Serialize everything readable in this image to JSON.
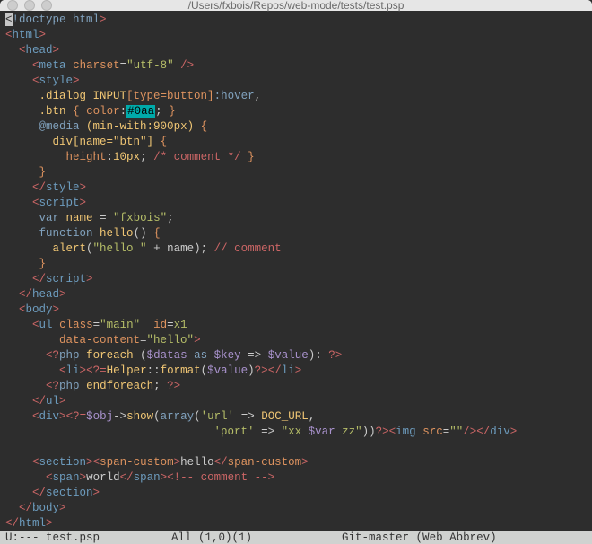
{
  "window": {
    "title": "/Users/fxbois/Repos/web-mode/tests/test.psp"
  },
  "modeline": {
    "left": "U:---  test.psp",
    "mid": "All (1,0)(1)",
    "right": "Git-master  (Web Abbrev)"
  },
  "code": {
    "l1_a": "<",
    "l1_b": "!doctype html",
    "l1_c": ">",
    "l2_a": "<",
    "l2_tag": "html",
    "l2_c": ">",
    "l3_pre": "  ",
    "l3_a": "<",
    "l3_tag": "head",
    "l3_c": ">",
    "l4_pre": "    ",
    "l4_a": "<",
    "l4_tag": "meta",
    "l4_sp": " ",
    "l4_attr": "charset",
    "l4_eq": "=",
    "l4_val": "\"utf-8\"",
    "l4_close": " />",
    "l5_pre": "    ",
    "l5_a": "<",
    "l5_tag": "style",
    "l5_c": ">",
    "l6_pre": "     ",
    "l6_sel": ".dialog INPUT",
    "l6_bsel": "[type=button]",
    "l6_pc": ":hover",
    "l6_comma": ",",
    "l7_pre": "     ",
    "l7_sel": ".btn",
    "l7_sp": " ",
    "l7_b": "{",
    "l7_sp2": " ",
    "l7_prop": "color",
    "l7_colon": ":",
    "l7_val": "#0aa",
    "l7_semi": ";",
    "l7_sp3": " ",
    "l7_bc": "}",
    "l8_pre": "     ",
    "l8_at": "@media",
    "l8_sp": " ",
    "l8_p": "(min-with:900px)",
    "l8_sp2": " ",
    "l8_b": "{",
    "l9_pre": "       ",
    "l9_sel": "div[name=\"btn\"]",
    "l9_sp": " ",
    "l9_b": "{",
    "l10_pre": "         ",
    "l10_prop": "height",
    "l10_colon": ":",
    "l10_val": "10px",
    "l10_semi": ";",
    "l10_sp": " ",
    "l10_cmt": "/* comment */",
    "l10_sp2": " ",
    "l10_bc": "}",
    "l11_pre": "     ",
    "l11_bc": "}",
    "l12_pre": "    ",
    "l12_a": "</",
    "l12_tag": "style",
    "l12_c": ">",
    "l13_pre": "    ",
    "l13_a": "<",
    "l13_tag": "script",
    "l13_c": ">",
    "l14_pre": "     ",
    "l14_kw": "var",
    "l14_sp": " ",
    "l14_name": "name",
    "l14_rest": " = ",
    "l14_str": "\"fxbois\"",
    "l14_semi": ";",
    "l15_pre": "     ",
    "l15_kw": "function",
    "l15_sp": " ",
    "l15_fn": "hello",
    "l15_rest": "() ",
    "l15_b": "{",
    "l16_pre": "       ",
    "l16_fn": "alert",
    "l16_p": "(",
    "l16_str": "\"hello \"",
    "l16_rest": " + name); ",
    "l16_cmt": "// comment",
    "l17_pre": "     ",
    "l17_bc": "}",
    "l18_pre": "    ",
    "l18_a": "</",
    "l18_tag": "script",
    "l18_c": ">",
    "l19_pre": "  ",
    "l19_a": "</",
    "l19_tag": "head",
    "l19_c": ">",
    "l20_pre": "  ",
    "l20_a": "<",
    "l20_tag": "body",
    "l20_c": ">",
    "l21_pre": "    ",
    "l21_a": "<",
    "l21_tag": "ul",
    "l21_sp": " ",
    "l21_at1": "class",
    "l21_eq1": "=",
    "l21_v1": "\"main\"",
    "l21_sp2": "  ",
    "l21_at2": "id",
    "l21_eq2": "=",
    "l21_v2": "x1",
    "l22_pre": "        ",
    "l22_at3": "data-content",
    "l22_eq3": "=",
    "l22_v3": "\"hello\"",
    "l22_c": ">",
    "l23_pre": "      ",
    "l23_a": "<?",
    "l23_php": "php",
    "l23_sp": " ",
    "l23_fe": "foreach",
    "l23_sp2": " (",
    "l23_var1": "$datas",
    "l23_sp3": " ",
    "l23_as": "as",
    "l23_sp4": " ",
    "l23_var2": "$key",
    "l23_arr": " => ",
    "l23_var3": "$value",
    "l23_p": "): ",
    "l23_c": "?>",
    "l24_pre": "        ",
    "l24_a": "<",
    "l24_tag": "li",
    "l24_c": ">",
    "l24_o2": "<?=",
    "l24_hlp": "Helper",
    "l24_dd": "::",
    "l24_fn": "format",
    "l24_p": "(",
    "l24_var": "$value",
    "l24_p2": ")",
    "l24_c2": "?>",
    "l24_lc": "</",
    "l24_tag2": "li",
    "l24_lc2": ">",
    "l25_pre": "      ",
    "l25_a": "<?",
    "l25_php": "php",
    "l25_sp": " ",
    "l25_ef": "endforeach",
    "l25_semi": ";",
    "l25_sp2": " ",
    "l25_c": "?>",
    "l26_pre": "    ",
    "l26_a": "</",
    "l26_tag": "ul",
    "l26_c": ">",
    "l27_pre": "    ",
    "l27_a": "<",
    "l27_tag": "div",
    "l27_c": ">",
    "l27_o2": "<?=",
    "l27_var": "$obj",
    "l27_arr": "->",
    "l27_fn": "show",
    "l27_p": "(",
    "l27_arr2": "array",
    "l27_p2": "(",
    "l27_k1": "'url'",
    "l27_ar": " => ",
    "l27_cn": "DOC_URL",
    "l27_comma": ",",
    "l28_pre": "                               ",
    "l28_k2": "'port'",
    "l28_ar": " => ",
    "l28_str": "\"xx ",
    "l28_var": "$var",
    "l28_str2": " zz\"",
    "l28_p": "))",
    "l28_c": "?>",
    "l28_lc": "<",
    "l28_tag": "img",
    "l28_sp": " ",
    "l28_at": "src",
    "l28_eq": "=",
    "l28_v": "\"\"",
    "l28_cl": "/>",
    "l28_lc2": "</",
    "l28_tag2": "div",
    "l28_lc3": ">",
    "l29": "",
    "l30_pre": "    ",
    "l30_a": "<",
    "l30_tag": "section",
    "l30_c": ">",
    "l30_a2": "<",
    "l30_tag2": "span-custom",
    "l30_c2": ">",
    "l30_txt": "hello",
    "l30_a3": "</",
    "l30_tag3": "span-custom",
    "l30_c3": ">",
    "l31_pre": "      ",
    "l31_a": "<",
    "l31_tag": "span",
    "l31_c": ">",
    "l31_txt": "world",
    "l31_a2": "</",
    "l31_tag2": "span",
    "l31_c2": ">",
    "l31_cmt": "<!-- comment -->",
    "l32_pre": "    ",
    "l32_a": "</",
    "l32_tag": "section",
    "l32_c": ">",
    "l33_pre": "  ",
    "l33_a": "</",
    "l33_tag": "body",
    "l33_c": ">",
    "l34_a": "</",
    "l34_tag": "html",
    "l34_c": ">"
  }
}
